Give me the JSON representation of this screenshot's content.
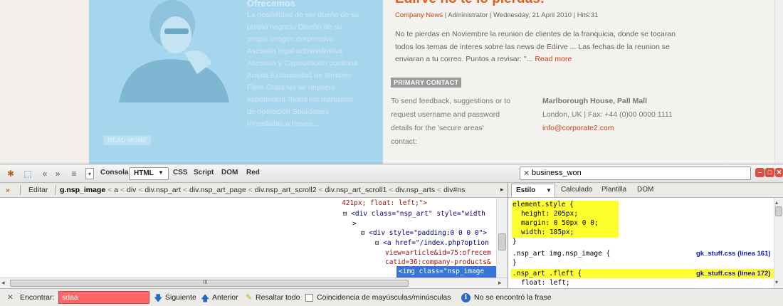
{
  "webpage": {
    "lead": {
      "title": "Ofrecemos",
      "text": "La posibilidad de ser dueño de su propio negocio Diseño de su propia imagen corporativa Asesoria legal-administrativa Asesoria y Capacitación continua Ampla Exclusividad de territorio Flete Grata No se requiere experiencia Todos los manuales de operación Soluciones Inmediatas a traves...",
      "read_more": "READ MORE"
    },
    "article": {
      "title": "Edirve no te lo pierdas!",
      "category": "Company News",
      "meta_rest": " | Administrator | Wednesday, 21 April 2010 | Hits:31",
      "body": "No te pierdas en Noviembre la reunion de clientes de la franquicia, donde se tocaran todos los temas de interes sobre las news de Edirve ... Las fechas de la reunion se enviaran a tu correo. Puntos a revisar: \"... ",
      "read_more": "Read more"
    },
    "contact": {
      "heading": "PRIMARY CONTACT",
      "left_text": "To send feedback, suggestions or to request username and password details for the 'secure areas' contact:",
      "address": "Marlborough House, Pall Mall",
      "city_fax": "London, UK  |  Fax: +44 (0)00 0000 1111",
      "email": "info@corporate2.com"
    }
  },
  "firebug": {
    "tabs": {
      "console": "Consola",
      "html": "HTML",
      "css": "CSS",
      "script": "Script",
      "dom": "DOM",
      "net": "Red"
    },
    "search_value": "business_won",
    "edit_label": "Editar",
    "breadcrumb": [
      "g.nsp_image",
      "a",
      "div",
      "div.nsp_art",
      "div.nsp_art_page",
      "div.nsp_art_scroll2",
      "div.nsp_art_scroll1",
      "div.nsp_arts",
      "div#ns"
    ],
    "side_tabs": {
      "style": "Estilo",
      "computed": "Calculado",
      "layout": "Plantilla",
      "dom": "DOM"
    },
    "html_lines": [
      "421px; float: left;\">",
      "<div class=\"nsp_art\" style=\"width",
      ">",
      "<div style=\"padding:0 0 0 0\">",
      "<a href=\"/index.php?option",
      "view=article&id=75:ofrecem",
      "catid=36:company-products&",
      "<img class=\"nsp_image"
    ],
    "css": {
      "element_style": "element.style {",
      "props": [
        "height: 205px;",
        "margin: 0 50px 0 0;",
        "width: 185px;"
      ],
      "close": "}",
      "rule1": ".nsp_art img.nsp_image {",
      "rule1_src": "gk_stuff.css (línea 161)",
      "rule2": ".nsp_art .fleft {",
      "rule2_src": "gk_stuff.css (línea 172)",
      "rule2_prop": "float: left;"
    },
    "hscroll_label": "III"
  },
  "findbar": {
    "label": "Encontrar:",
    "value": "sdaa",
    "next": "Siguiente",
    "prev": "Anterior",
    "highlight": "Resaltar todo",
    "match_case": "Coincidencia de mayúsculas/minúsculas",
    "status": "No se encontró la frase"
  }
}
